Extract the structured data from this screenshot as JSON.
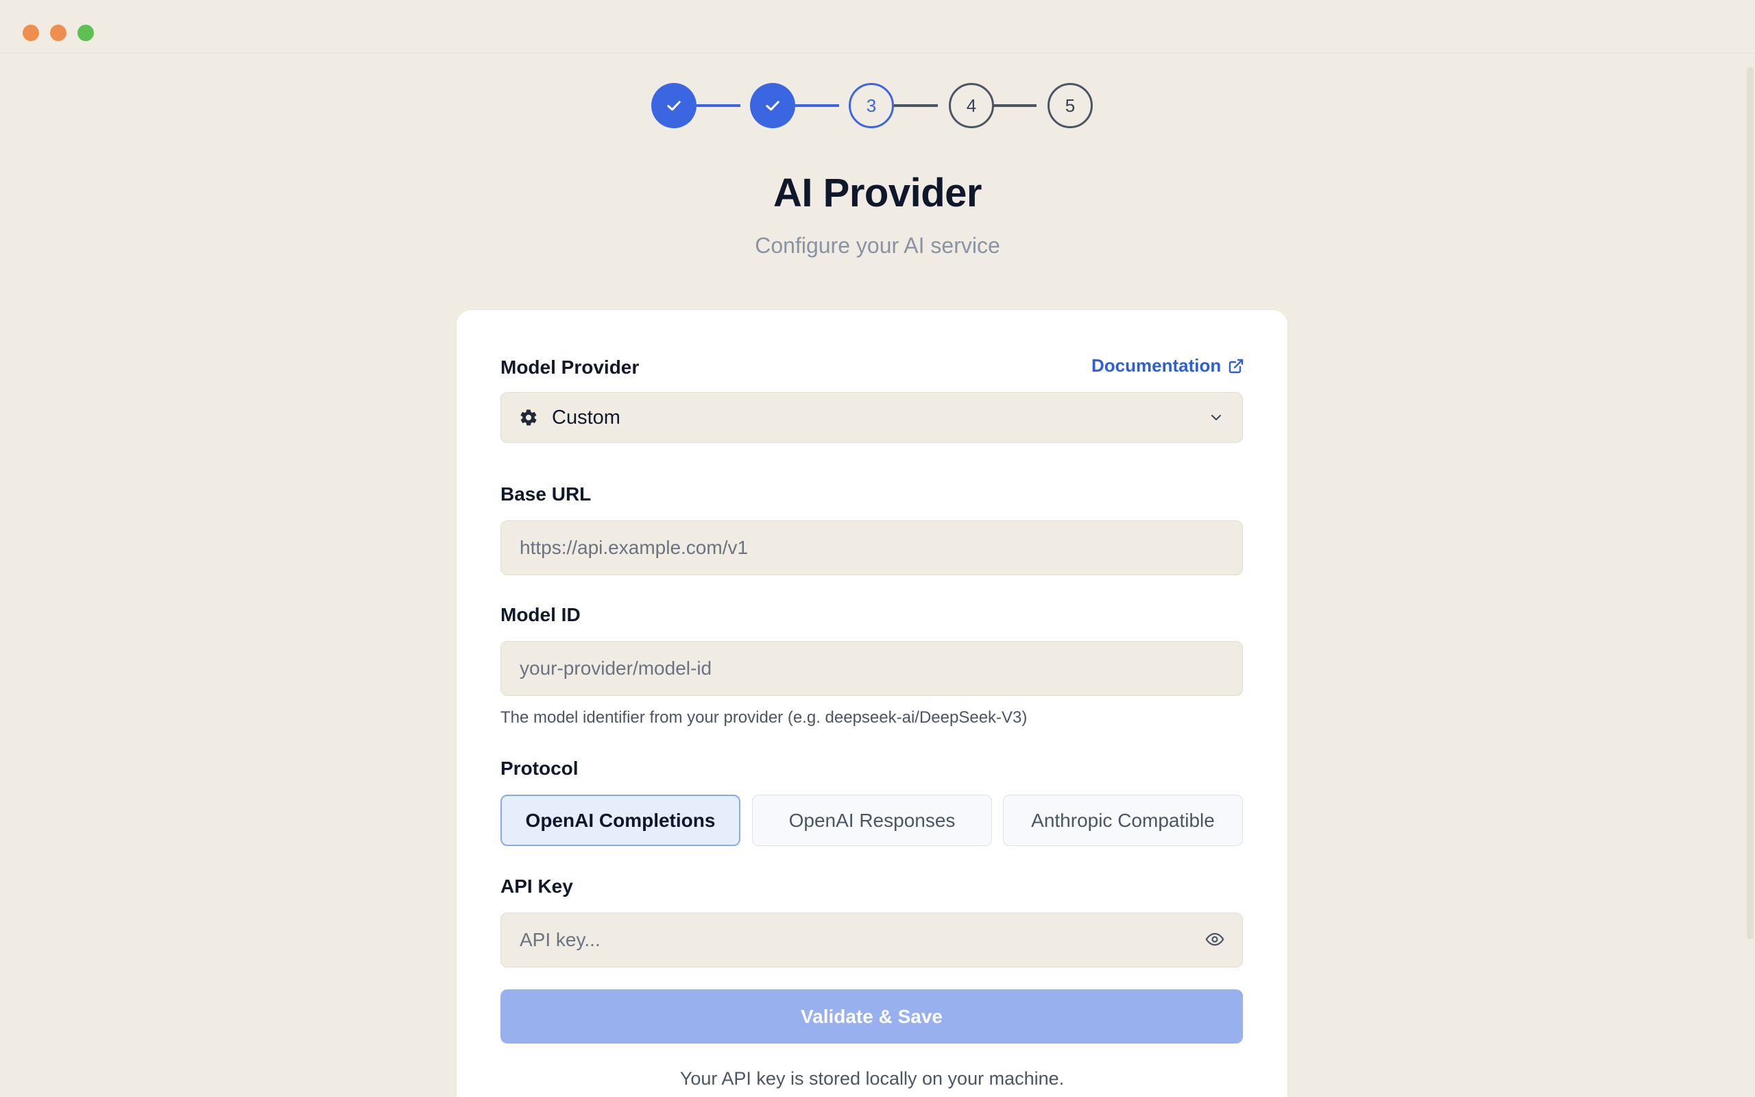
{
  "stepper": {
    "steps": [
      {
        "label": "",
        "state": "done"
      },
      {
        "label": "",
        "state": "done"
      },
      {
        "label": "3",
        "state": "current"
      },
      {
        "label": "4",
        "state": "todo"
      },
      {
        "label": "5",
        "state": "todo"
      }
    ]
  },
  "page": {
    "title": "AI Provider",
    "subtitle": "Configure your AI service"
  },
  "model_provider": {
    "label": "Model Provider",
    "doc_link": "Documentation",
    "selected": "Custom",
    "icon": "gear-icon"
  },
  "base_url": {
    "label": "Base URL",
    "value": "",
    "placeholder": "https://api.example.com/v1"
  },
  "model_id": {
    "label": "Model ID",
    "value": "",
    "placeholder": "your-provider/model-id",
    "helper": "The model identifier from your provider (e.g. deepseek-ai/DeepSeek-V3)"
  },
  "protocol": {
    "label": "Protocol",
    "options": [
      "OpenAI Completions",
      "OpenAI Responses",
      "Anthropic Compatible"
    ],
    "selected": "OpenAI Completions"
  },
  "api_key": {
    "label": "API Key",
    "value": "",
    "placeholder": "API key..."
  },
  "actions": {
    "save_label": "Validate & Save"
  },
  "footnote": "Your API key is stored locally on your machine.",
  "colors": {
    "accent": "#3b66e1",
    "background": "#f0ece3",
    "save_disabled": "#98b0ee"
  }
}
